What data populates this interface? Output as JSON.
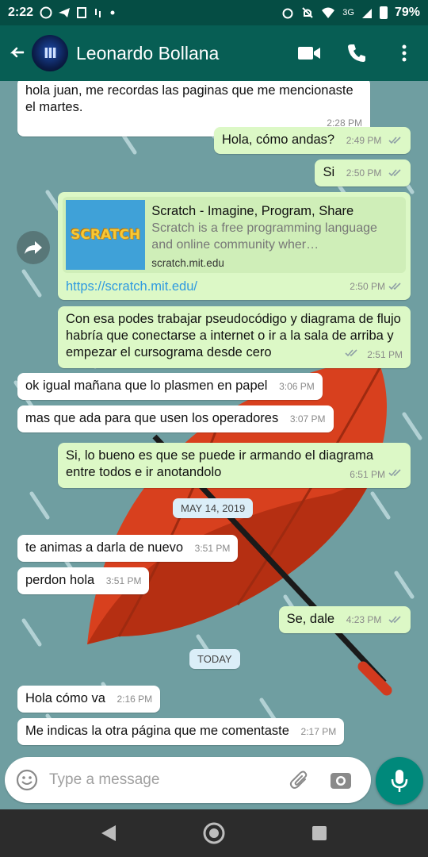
{
  "statusbar": {
    "time": "2:22",
    "network": "3G",
    "battery": "79%"
  },
  "header": {
    "contact_name": "Leonardo Bollana",
    "avatar_text": "Ⅲ"
  },
  "messages": [
    {
      "dir": "in",
      "text": "hola juan, me recordas las paginas que me mencionaste el martes.",
      "time": "2:28 PM"
    },
    {
      "dir": "out",
      "text": "Hola, cómo andas?",
      "time": "2:49 PM"
    },
    {
      "dir": "out",
      "text": "Si",
      "time": "2:50 PM"
    },
    {
      "dir": "out",
      "link_card": {
        "title": "Scratch - Imagine, Program, Share",
        "description": "Scratch is a free programming language and online community wher…",
        "domain": "scratch.mit.edu",
        "thumb_text": "SCRATCH"
      },
      "text": "https://scratch.mit.edu/",
      "time": "2:50 PM"
    },
    {
      "dir": "out",
      "text": "Con esa podes trabajar pseudocódigo y diagrama de flujo habría que conectarse a internet o ir a la sala de arriba y empezar el cursograma desde cero",
      "time": "2:51 PM"
    },
    {
      "dir": "in",
      "text": "ok igual mañana que lo plasmen en papel",
      "time": "3:06 PM"
    },
    {
      "dir": "in",
      "text": "mas que ada para que usen los operadores",
      "time": "3:07 PM"
    },
    {
      "dir": "out",
      "text": "Si, lo bueno es que se puede ir armando el diagrama entre todos e ir anotandolo",
      "time": "6:51 PM"
    },
    {
      "dir": "in",
      "text": "te animas a darla de nuevo",
      "time": "3:51 PM"
    },
    {
      "dir": "in",
      "text": "perdon hola",
      "time": "3:51 PM"
    },
    {
      "dir": "out",
      "text": "Se, dale",
      "time": "4:23 PM"
    },
    {
      "dir": "in",
      "text": "Hola cómo va",
      "time": "2:16 PM"
    },
    {
      "dir": "in",
      "text": "Me indicas la otra página que me comentaste",
      "time": "2:17 PM"
    }
  ],
  "date_chips": [
    "MAY 14, 2019",
    "TODAY"
  ],
  "composer": {
    "placeholder": "Type a message"
  },
  "colors": {
    "header": "#075e54",
    "statusbar": "#054d44",
    "outgoing": "#dcf8c6",
    "incoming": "#ffffff",
    "accent": "#00897b",
    "link": "#2f9ae0"
  },
  "icons": [
    "back-arrow-icon",
    "video-call-icon",
    "phone-icon",
    "more-vert-icon",
    "forward-icon",
    "emoji-icon",
    "attach-icon",
    "camera-icon",
    "mic-icon",
    "nav-back-icon",
    "nav-home-icon",
    "nav-recents-icon"
  ]
}
